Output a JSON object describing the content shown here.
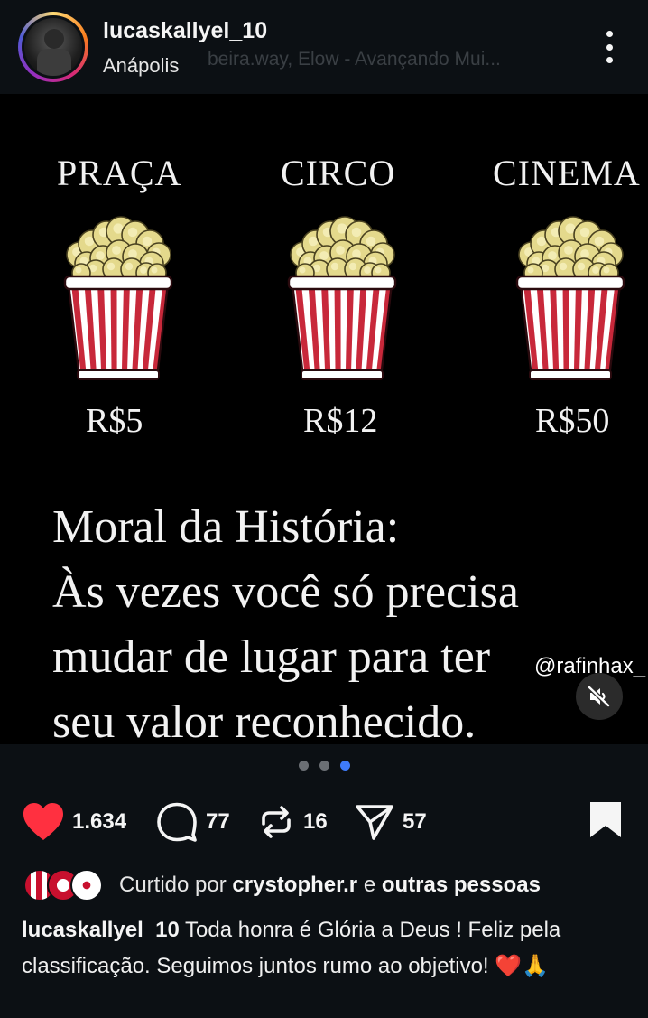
{
  "header": {
    "username": "lucaskallyel_10",
    "location": "Anápolis",
    "music_overlay": "beira.way, Elow - Avançando Mui..."
  },
  "post": {
    "venues": [
      {
        "name": "PRAÇA",
        "price": "R$5"
      },
      {
        "name": "CIRCO",
        "price": "R$12"
      },
      {
        "name": "CINEMA",
        "price": "R$50"
      }
    ],
    "moral_lines": [
      "Moral da História:",
      "Às vezes você só precisa",
      "mudar de lugar para ter",
      "seu valor reconhecido."
    ],
    "watermark": "@rafinhax_",
    "carousel": {
      "total": 3,
      "active_index": 2
    }
  },
  "actions": {
    "likes": "1.634",
    "comments": "77",
    "reposts": "16",
    "shares": "57"
  },
  "liked_by": {
    "prefix": "Curtido por",
    "user": "crystopher.r",
    "joiner": "e",
    "others": "outras pessoas"
  },
  "caption": {
    "author": "lucaskallyel_10",
    "text": "Toda honra é Glória a Deus ! Feliz pela classificação. Seguimos juntos rumo ao objetivo! ❤️🙏"
  },
  "colors": {
    "background": "#0c1014",
    "like_red": "#ff3040",
    "dot_active": "#3e7bfa",
    "bucket_red": "#c8283a"
  }
}
